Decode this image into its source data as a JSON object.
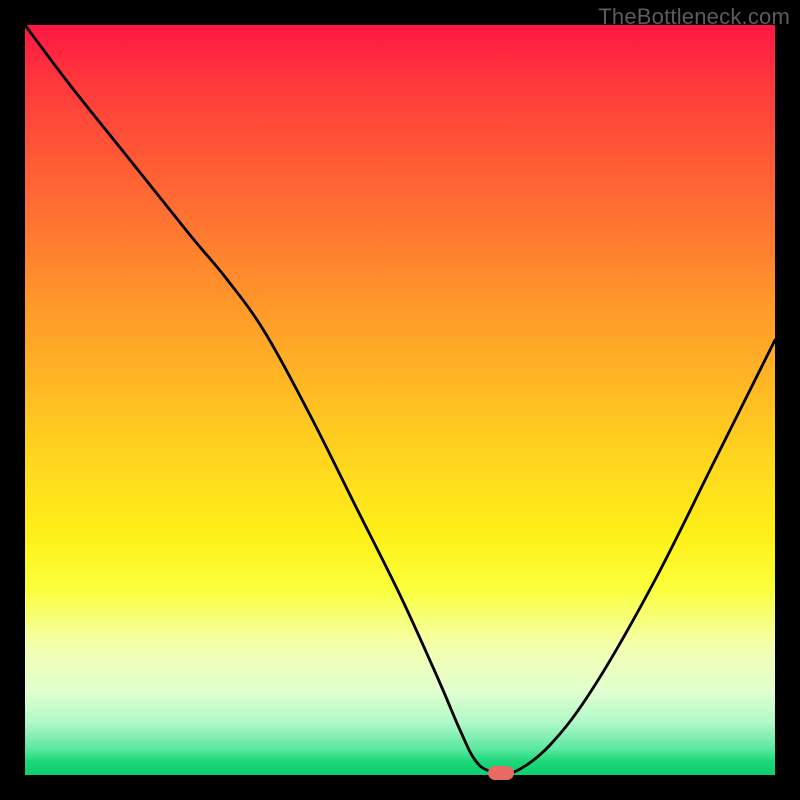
{
  "watermark": "TheBottleneck.com",
  "chart_data": {
    "type": "line",
    "title": "",
    "xlabel": "",
    "ylabel": "",
    "xlim": [
      0,
      100
    ],
    "ylim": [
      0,
      100
    ],
    "curve": {
      "x": [
        0,
        6,
        14,
        22,
        27,
        32,
        38,
        44,
        50,
        55,
        58,
        60,
        62,
        65,
        70,
        76,
        84,
        92,
        100
      ],
      "y": [
        100,
        92,
        82,
        72,
        66,
        59,
        48,
        36,
        24,
        13,
        6,
        2,
        0.5,
        0.3,
        4,
        12,
        26,
        42,
        58
      ]
    },
    "marker": {
      "x": 63.5,
      "y": 0.3
    },
    "background_gradient_stops": [
      {
        "pos": 0.0,
        "color": "#ff1744"
      },
      {
        "pos": 0.5,
        "color": "#ffd61e"
      },
      {
        "pos": 0.8,
        "color": "#fbff3a"
      },
      {
        "pos": 1.0,
        "color": "#0bcf70"
      }
    ]
  }
}
